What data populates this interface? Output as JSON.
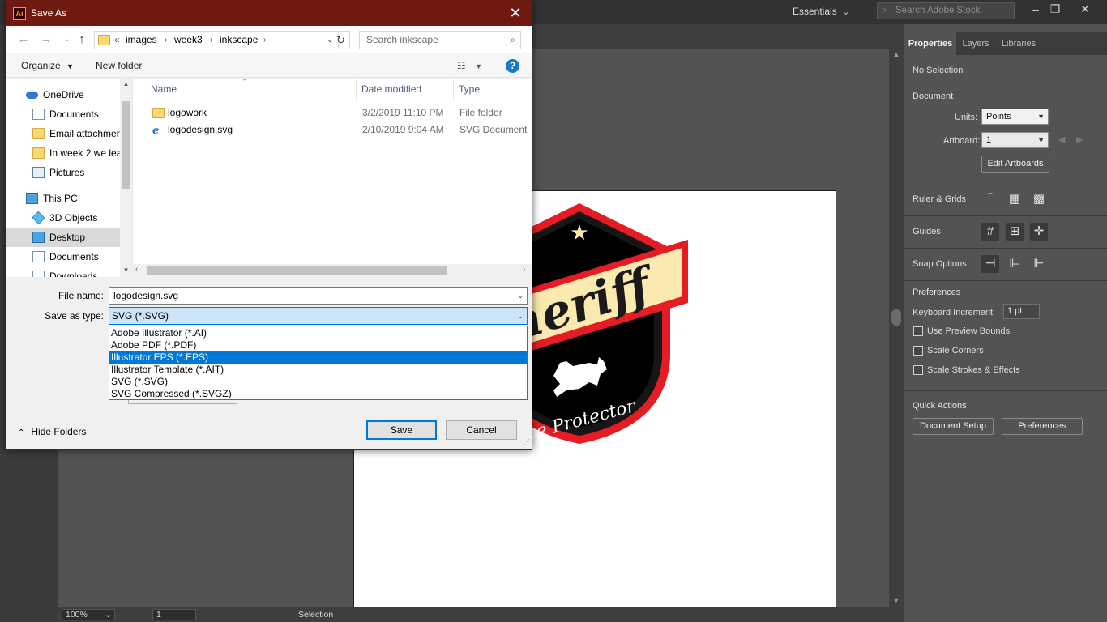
{
  "illustrator": {
    "workspace_label": "Essentials",
    "stock_search_placeholder": "Search Adobe Stock",
    "status": {
      "zoom": "100%",
      "artboard_number": "1",
      "tool": "Selection"
    },
    "artwork": {
      "banner_text": "heriff",
      "tagline": "he Protector"
    }
  },
  "properties_panel": {
    "tabs": [
      "Properties",
      "Layers",
      "Libraries"
    ],
    "selection_state": "No Selection",
    "document_heading": "Document",
    "units_label": "Units:",
    "units_value": "Points",
    "artboard_label": "Artboard:",
    "artboard_value": "1",
    "edit_artboards_label": "Edit Artboards",
    "ruler_grids_heading": "Ruler & Grids",
    "guides_heading": "Guides",
    "snap_heading": "Snap Options",
    "preferences_heading": "Preferences",
    "keyboard_increment_label": "Keyboard Increment:",
    "keyboard_increment_value": "1 pt",
    "checkboxes": [
      "Use Preview Bounds",
      "Scale Corners",
      "Scale Strokes & Effects"
    ],
    "quick_actions_heading": "Quick Actions",
    "document_setup_label": "Document Setup",
    "preferences_button_label": "Preferences"
  },
  "dialog": {
    "title": "Save As",
    "app_icon_text": "Ai",
    "breadcrumb": [
      "images",
      "week3",
      "inkscape"
    ],
    "breadcrumb_prefix": "«",
    "search_placeholder": "Search inkscape",
    "organize_label": "Organize",
    "new_folder_label": "New folder",
    "nav_items": [
      {
        "label": "OneDrive"
      },
      {
        "label": "Documents"
      },
      {
        "label": "Email attachmer"
      },
      {
        "label": "In week 2 we lea"
      },
      {
        "label": "Pictures"
      },
      {
        "label": "This PC"
      },
      {
        "label": "3D Objects"
      },
      {
        "label": "Desktop"
      },
      {
        "label": "Documents"
      },
      {
        "label": "Downloads"
      }
    ],
    "columns": [
      "Name",
      "Date modified",
      "Type"
    ],
    "files": [
      {
        "name": "logowork",
        "date": "3/2/2019 11:10 PM",
        "type": "File folder"
      },
      {
        "name": "logodesign.svg",
        "date": "2/10/2019 9:04 AM",
        "type": "SVG Document"
      }
    ],
    "file_name_label": "File name:",
    "file_name_value": "logodesign.svg",
    "save_type_label": "Save as type:",
    "save_type_value": "SVG (*.SVG)",
    "type_options": [
      "Adobe Illustrator (*.AI)",
      "Adobe PDF (*.PDF)",
      "Illustrator EPS (*.EPS)",
      "Illustrator Template (*.AIT)",
      "SVG (*.SVG)",
      "SVG Compressed (*.SVGZ)"
    ],
    "highlighted_option": "Illustrator EPS (*.EPS)",
    "hide_folders_label": "Hide Folders",
    "save_label": "Save",
    "cancel_label": "Cancel"
  },
  "colors": {
    "dialog_titlebar": "#6f1911",
    "selection_blue": "#0078d7",
    "illustrator_bg": "#535353",
    "badge_red": "#e51c23",
    "banner_cream": "#fbeab0"
  }
}
